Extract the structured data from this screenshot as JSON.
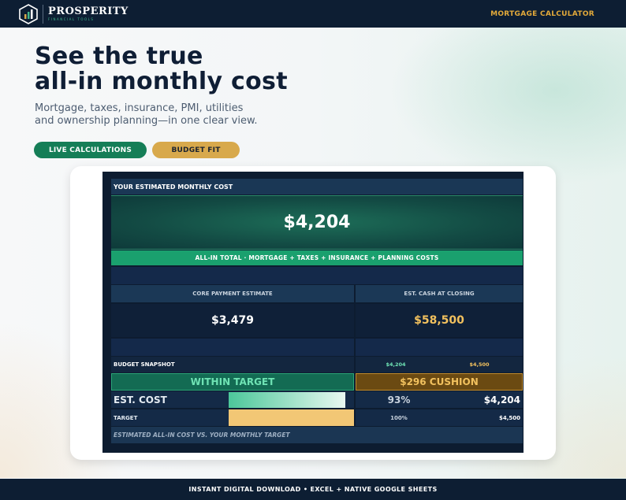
{
  "brand": {
    "name": "PROSPERITY",
    "tagline": "FINANCIAL TOOLS",
    "nav_link": "MORTGAGE CALCULATOR"
  },
  "hero": {
    "title_line1": "See the true",
    "title_line2": "all-in monthly cost",
    "subtitle_line1": "Mortgage, taxes, insurance, PMI, utilities",
    "subtitle_line2": "and ownership planning—in one clear view.",
    "pill_live": "LIVE CALCULATIONS",
    "pill_budget": "BUDGET FIT"
  },
  "sheet": {
    "header": "YOUR ESTIMATED MONTHLY COST",
    "total_value": "$4,204",
    "total_caption": "ALL-IN TOTAL  ·  MORTGAGE + TAXES + INSURANCE + PLANNING COSTS",
    "core_label": "CORE PAYMENT ESTIMATE",
    "core_value": "$3,479",
    "cash_label": "EST. CASH AT CLOSING",
    "cash_value": "$58,500",
    "budget_label": "BUDGET SNAPSHOT",
    "budget_cost_small": "$4,204",
    "budget_target_small": "$4,500",
    "status_within": "WITHIN TARGET",
    "status_cushion": "$296 CUSHION",
    "est_cost_label": "EST. COST",
    "est_cost_pct": "93%",
    "est_cost_value": "$4,204",
    "target_label": "TARGET",
    "target_pct": "100%",
    "target_value": "$4,500",
    "footer_note": "ESTIMATED ALL-IN COST VS. YOUR MONTHLY TARGET",
    "est_cost_fill": 0.93,
    "target_fill": 1.0
  },
  "colors": {
    "navy": "#0d1e33",
    "green": "#157e57",
    "gold": "#d8a94c",
    "accent_gold": "#f2c15e",
    "accent_green": "#6fe3b4"
  },
  "footer": {
    "text": "INSTANT DIGITAL DOWNLOAD • EXCEL + NATIVE GOOGLE SHEETS"
  }
}
